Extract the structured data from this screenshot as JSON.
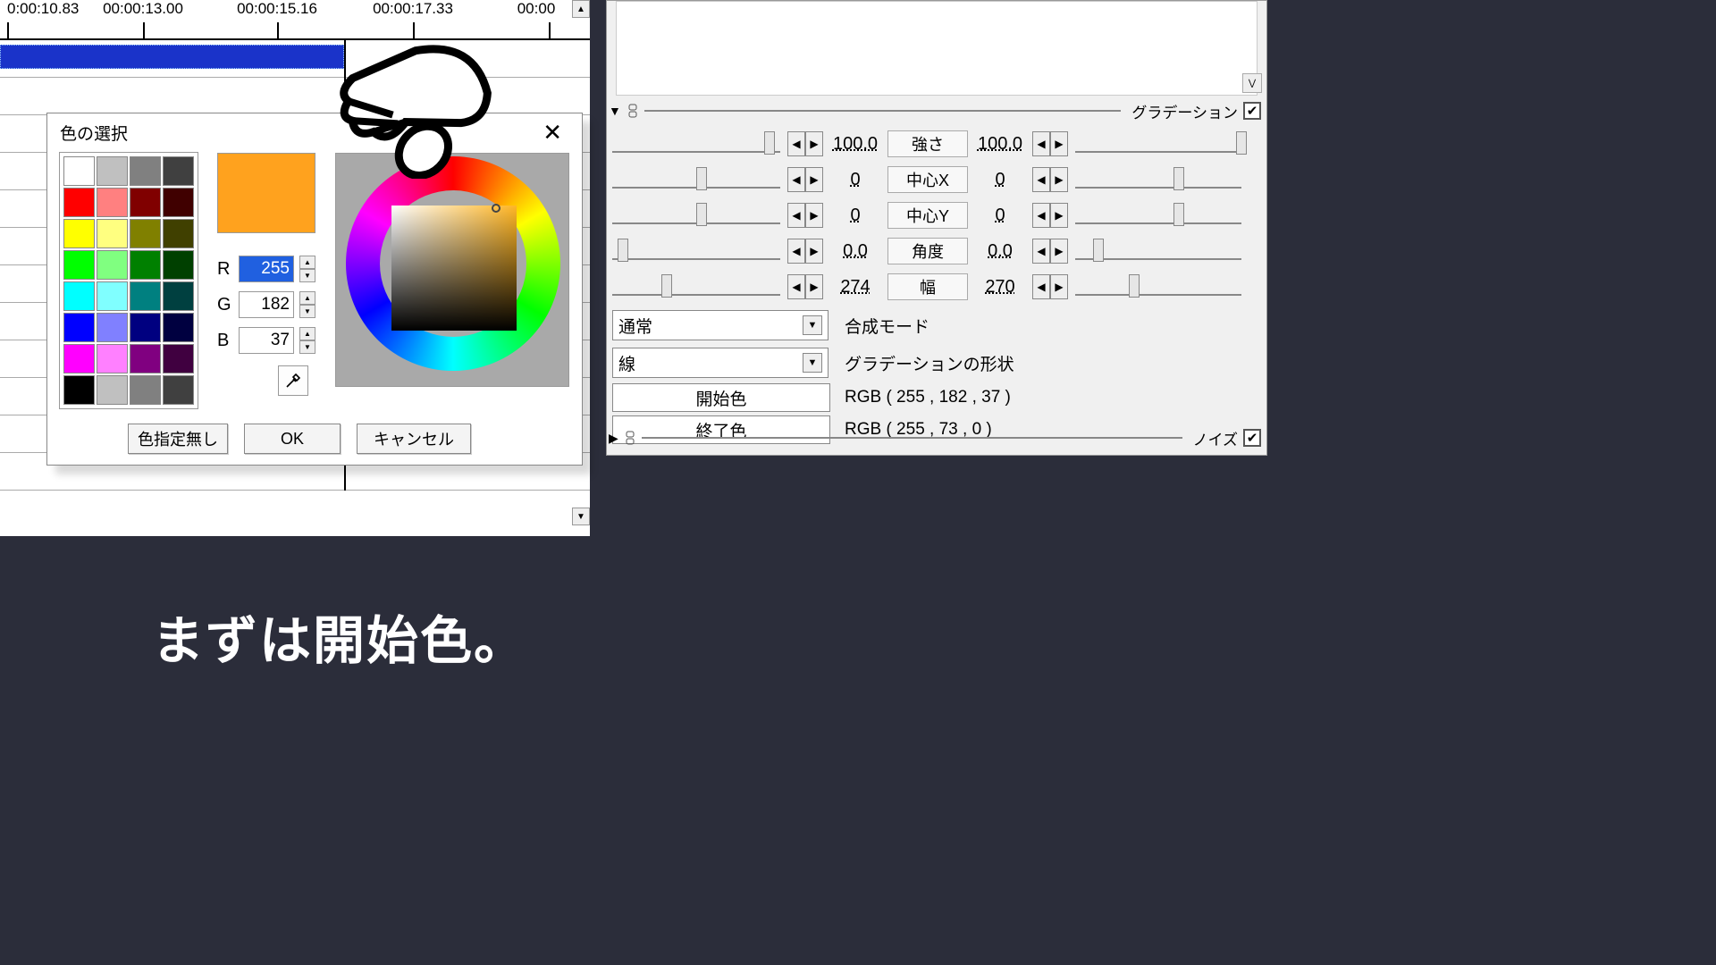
{
  "timeline": {
    "ticks": [
      "0:00:10.83",
      "00:00:13.00",
      "00:00:15.16",
      "00:00:17.33",
      "00:00"
    ]
  },
  "color_dialog": {
    "title": "色の選択",
    "r_label": "R",
    "g_label": "G",
    "b_label": "B",
    "r": "255",
    "g": "182",
    "b": "37",
    "no_color": "色指定無し",
    "ok": "OK",
    "cancel": "キャンセル",
    "preview_color": "#ffa21e",
    "swatch_grid": [
      "#ffffff",
      "#c0c0c0",
      "#808080",
      "#404040",
      "#ff0000",
      "#ff8080",
      "#800000",
      "#400000",
      "#ffff00",
      "#ffff80",
      "#808000",
      "#404000",
      "#00ff00",
      "#80ff80",
      "#008000",
      "#004000",
      "#00ffff",
      "#80ffff",
      "#008080",
      "#004040",
      "#0000ff",
      "#8080ff",
      "#000080",
      "#000040",
      "#ff00ff",
      "#ff80ff",
      "#800080",
      "#400040",
      "#000000",
      "#c0c0c0",
      "#808080",
      "#404040"
    ]
  },
  "gradient": {
    "section": "グラデーション",
    "params": [
      {
        "name": "強さ",
        "lval": "100.0",
        "rval": "100.0",
        "lthumb": 170,
        "rthumb": 180
      },
      {
        "name": "中心X",
        "lval": "0",
        "rval": "0",
        "lthumb": 94,
        "rthumb": 110
      },
      {
        "name": "中心Y",
        "lval": "0",
        "rval": "0",
        "lthumb": 94,
        "rthumb": 110
      },
      {
        "name": "角度",
        "lval": "0.0",
        "rval": "0.0",
        "lthumb": 6,
        "rthumb": 20
      },
      {
        "name": "幅",
        "lval": "274",
        "rval": "270",
        "lthumb": 55,
        "rthumb": 60
      }
    ],
    "blend_label": "合成モード",
    "blend_value": "通常",
    "shape_label": "グラデーションの形状",
    "shape_value": "線",
    "start_label": "開始色",
    "end_label": "終了色",
    "start_rgb": "RGB ( 255 , 182 , 37 )",
    "end_rgb": "RGB ( 255 , 73 , 0 )",
    "noise_label": "ノイズ"
  },
  "subtitle": "まずは開始色。"
}
